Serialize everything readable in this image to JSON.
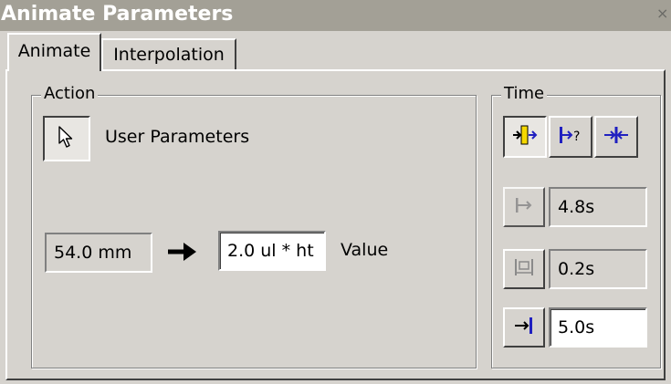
{
  "window": {
    "title": "Animate Parameters",
    "close_glyph": "×"
  },
  "tabs": [
    {
      "label": "Animate",
      "active": true
    },
    {
      "label": "Interpolation",
      "active": false
    }
  ],
  "action": {
    "group_title": "Action",
    "selector_icon": "cursor-arrow-icon",
    "mode_label": "User Parameters",
    "start_value": "54.0 mm",
    "arrow_icon": "right-arrow-icon",
    "end_value": "2.0 ul * ht",
    "value_label": "Value"
  },
  "time": {
    "group_title": "Time",
    "mode_buttons": [
      {
        "icon": "time-current-icon",
        "pressed": true
      },
      {
        "icon": "time-query-icon",
        "pressed": false
      },
      {
        "icon": "time-range-icon",
        "pressed": false
      }
    ],
    "start": {
      "icon": "start-time-icon",
      "value": "4.8s"
    },
    "duration": {
      "icon": "duration-icon",
      "value": "0.2s"
    },
    "end": {
      "icon": "end-time-icon",
      "value": "5.0s"
    }
  },
  "colors": {
    "title_bg": "#a3a096",
    "dialog_bg": "#d6d3ce",
    "icon_accent": "#2020c0",
    "highlight_yellow": "#f5d800"
  }
}
